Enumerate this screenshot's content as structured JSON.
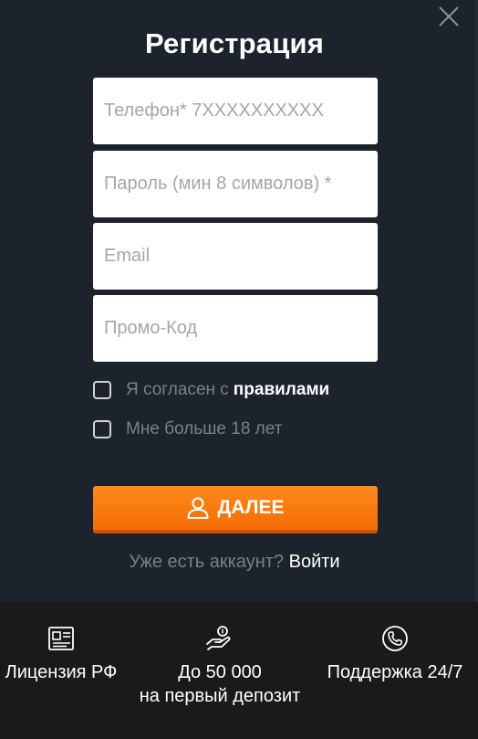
{
  "modal": {
    "title": "Регистрация",
    "fields": {
      "phone_placeholder": "Телефон* 7XXXXXXXXXX",
      "password_placeholder": "Пароль (мин 8 символов) *",
      "email_placeholder": "Email",
      "promo_placeholder": "Промо-Код"
    },
    "checks": {
      "agree_text": "Я согласен с ",
      "agree_link": "правилами",
      "age_text": "Мне больше 18 лет"
    },
    "submit_label": "ДАЛЕЕ",
    "login": {
      "text": "Уже есть аккаунт? ",
      "link": "Войти"
    }
  },
  "footer": {
    "features": [
      {
        "icon": "license-document-icon",
        "line1": "Лицензия РФ",
        "line2": ""
      },
      {
        "icon": "hand-coin-icon",
        "line1": "До 50 000",
        "line2": "на первый депозит"
      },
      {
        "icon": "phone-support-icon",
        "line1": "Поддержка 24/7",
        "line2": ""
      }
    ]
  },
  "colors": {
    "background": "#1c232c",
    "accent": "#f57a0c",
    "footer": "#1a1a1a"
  }
}
